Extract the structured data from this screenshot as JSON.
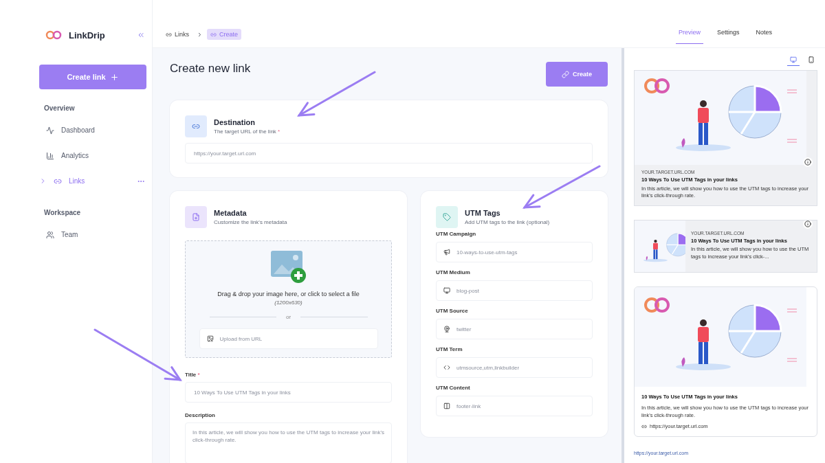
{
  "sidebar": {
    "brand": "LinkDrip",
    "create_button": "Create link",
    "sections": [
      {
        "title": "Overview",
        "items": [
          {
            "label": "Dashboard",
            "selected": false,
            "kind": "plain"
          },
          {
            "label": "Analytics",
            "selected": false,
            "kind": "plain"
          },
          {
            "label": "Links",
            "selected": true,
            "kind": "expandable",
            "expanded": false
          }
        ]
      },
      {
        "title": "Workspace",
        "items": [
          {
            "label": "Team",
            "selected": false,
            "kind": "plain"
          }
        ]
      }
    ]
  },
  "breadcrumb": [
    {
      "label": "Links",
      "selected": false
    },
    {
      "label": "Create",
      "selected": true
    }
  ],
  "tabs": [
    {
      "label": "Preview",
      "selected": true
    },
    {
      "label": "Settings",
      "selected": false
    },
    {
      "label": "Notes",
      "selected": false
    }
  ],
  "main": {
    "title": "Create new link",
    "create_button": "Create",
    "destination": {
      "title": "Destination",
      "subtitle": "The target URL of the link",
      "required_mark": "*",
      "placeholder": "https://your.target.url.com"
    },
    "metadata": {
      "title": "Metadata",
      "subtitle": "Customize the link's metadata",
      "drop_text": "Drag & drop your image here, or click to select a file",
      "drop_size": "(1200x630)",
      "or": "or",
      "upload_placeholder": "Upload from URL",
      "title_field": {
        "label": "Title",
        "required_mark": "*",
        "placeholder": "10 Ways To Use UTM Tags in your links"
      },
      "description_field": {
        "label": "Description",
        "placeholder": "In this article, we will show you how to use the UTM tags to increase your link's click-through rate."
      }
    },
    "utm": {
      "title": "UTM Tags",
      "subtitle": "Add UTM tags to the link (optional)",
      "fields": [
        {
          "label": "UTM Campaign",
          "placeholder": "10-ways-to-use-utm-tags"
        },
        {
          "label": "UTM Medium",
          "placeholder": "blog-post"
        },
        {
          "label": "UTM Source",
          "placeholder": "twitter"
        },
        {
          "label": "UTM Term",
          "placeholder": "utmsource,utm,linkbuilder"
        },
        {
          "label": "UTM Content",
          "placeholder": "footer-link"
        }
      ]
    }
  },
  "preview": {
    "devices": [
      {
        "kind": "desktop",
        "selected": true
      },
      {
        "kind": "mobile",
        "selected": false
      }
    ],
    "cards": [
      {
        "kind": "large",
        "domain": "YOUR.TARGET.URL.COM",
        "title": "10 Ways To Use UTM Tags in your links",
        "description": "In this article, we will show you how to use the UTM tags to increase your link's click-through rate."
      },
      {
        "kind": "compact",
        "domain": "YOUR.TARGET.URL.COM",
        "title": "10 Ways To Use UTM Tags in your links",
        "description": "In this article, we will show you how to use the UTM tags to increase your link's click-..."
      },
      {
        "kind": "rich",
        "title": "10 Ways To Use UTM Tags in your links",
        "description": "In this article, we will show you how to use the UTM tags to increase your link's click-through rate.",
        "url": "https://your.target.url.com"
      }
    ],
    "footer_url": "https://your.target.url.com"
  }
}
